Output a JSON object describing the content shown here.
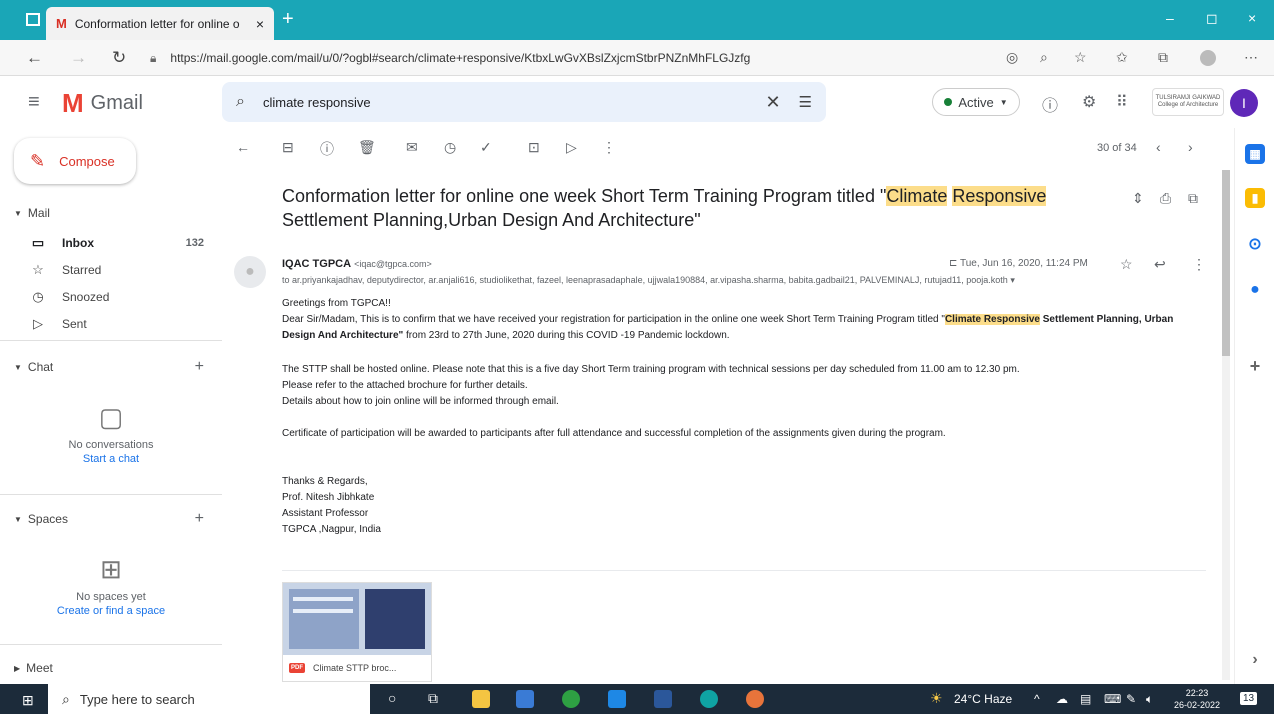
{
  "browser": {
    "tab_title": "Conformation letter for online o",
    "tab_logo": "M",
    "new_tab": "+",
    "tab_close": "×",
    "url": "https://mail.google.com/mail/u/0/?ogbl#search/climate+responsive/KtbxLwGvXBslZxjcmStbrPNZnMhFLGJzfg",
    "window_controls": [
      "–",
      "◻",
      "×"
    ]
  },
  "header": {
    "app_name": "Gmail",
    "logo_letter": "M",
    "search_query": "climate responsive",
    "status": "Active",
    "avatar_letter": "I",
    "org_badge": "TULSIRAMJI GAIKWAD College of Architecture"
  },
  "sidebar": {
    "compose_label": "Compose",
    "mail_label": "Mail",
    "items": [
      {
        "label": "Inbox",
        "count": "132",
        "icon": "inbox-icon"
      },
      {
        "label": "Starred",
        "count": "",
        "icon": "star-icon"
      },
      {
        "label": "Snoozed",
        "count": "",
        "icon": "clock-icon"
      },
      {
        "label": "Sent",
        "count": "",
        "icon": "send-icon"
      }
    ],
    "chat": {
      "label": "Chat",
      "empty_text": "No conversations",
      "start_link": "Start a chat"
    },
    "spaces": {
      "label": "Spaces",
      "empty_text": "No spaces yet",
      "create_link": "Create or find a space"
    },
    "meet_label": "Meet"
  },
  "toolbar": {
    "counter": "30 of 34"
  },
  "email": {
    "subject_prefix": "Conformation letter for online one week Short Term Training Program titled \"",
    "subject_hl1": "Climate",
    "subject_hl2": "Responsive",
    "subject_suffix": "Settlement Planning,Urban Design And Architecture\"",
    "sender_name": "IQAC TGPCA",
    "sender_email": "<iqac@tgpca.com>",
    "recipients": "to ar.priyankajadhav, deputydirector, ar.anjali616, studiolikethat, fazeel, leenaprasadaphale, ujjwala190884, ar.vipasha.sharma, babita.gadbail21, PALVEMINALJ, rutujad11, pooja.koth",
    "date": "Tue, Jun 16, 2020, 11:24 PM",
    "greeting": "Greetings from  TGPCA!!",
    "para1_start": "Dear Sir/Madam, This is to confirm that we have received your registration for participation in the online one week Short Term Training  Program titled  \"",
    "para1_hl": "Climate Responsive",
    "para1_bold": " Settlement Planning, Urban Design And Architecture\"",
    "para1_end": " from 23rd to 27th June, 2020 during this COVID -19 Pandemic lockdown.",
    "para2": "The STTP  shall be hosted online. Please note that this is a five day Short Term  training program with  technical sessions per day scheduled from 11.00 am to 12.30 pm.",
    "para3": "Please refer to the attached brochure for further details.",
    "para4": "Details about how to join online will be informed through email.",
    "para5": "Certificate of participation will be awarded to participants after full attendance and successful completion of the assignments given during the program.",
    "sign1": "Thanks & Regards,",
    "sign2": "Prof. Nitesh Jibhkate",
    "sign3": "Assistant Professor",
    "sign4": "TGPCA ,Nagpur, India",
    "attachment_name": "Climate STTP broc...",
    "attachment_type": "PDF"
  },
  "taskbar": {
    "search_placeholder": "Type here to search",
    "weather": "24°C  Haze",
    "time": "22:23",
    "date": "26-02-2022",
    "notification_count": "13"
  }
}
